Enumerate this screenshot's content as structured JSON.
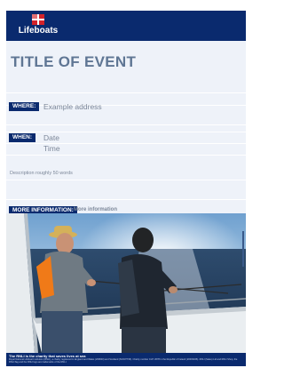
{
  "brand": {
    "name": "Lifeboats"
  },
  "event": {
    "title": "TITLE OF EVENT",
    "where_label": "WHERE:",
    "where_value": "Example address",
    "when_label": "WHEN:",
    "date": "Date",
    "time": "Time",
    "description": "Description roughly 50 words",
    "more_label": "MORE INFORMATION:",
    "more_value": "More information"
  },
  "photo": {
    "icon": "fishing-photo"
  },
  "footer": {
    "title": "The RNLI is the charity that saves lives at sea",
    "text": "Royal National Lifeboat Institution (RNLI), a charity registered in England and Wales (209603) and Scotland (SC037736). Charity number CHY 2678 in the Republic of Ireland (20003326). RNLI (Sales) Ltd and RNLI Shop, the RNLI flag and the RNLI logo are trademarks of the RNLI."
  },
  "colors": {
    "brand_blue": "#0a2a6e",
    "title": "#5f7694",
    "text": "#7c8799",
    "panel": "#eef2f9",
    "flag_red": "#d3222a"
  }
}
